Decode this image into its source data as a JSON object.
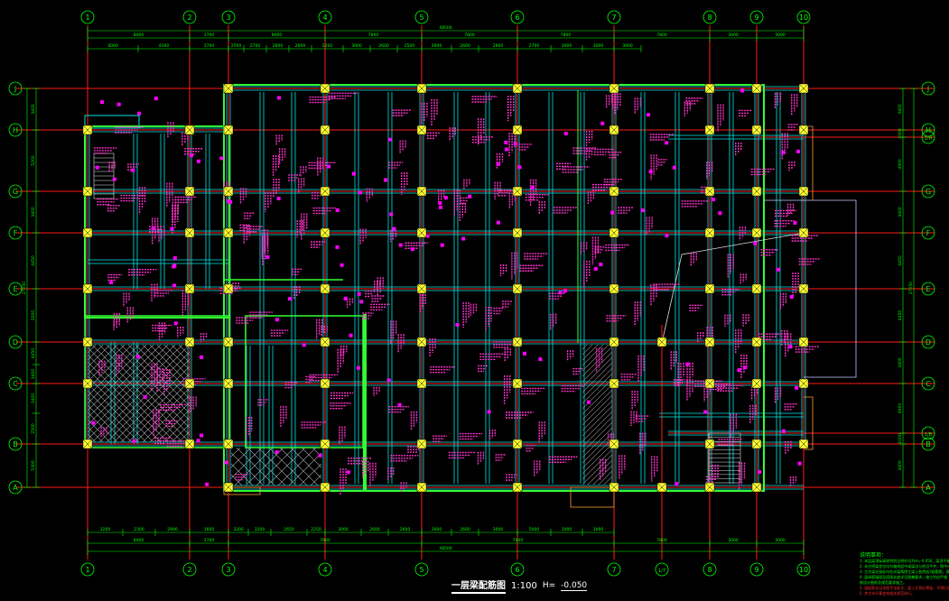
{
  "drawing": {
    "title": "一层梁配筋图",
    "scale": "1:100",
    "elevation_label": "H=",
    "elevation_value": "-0.050"
  },
  "axes": {
    "columns": [
      "1",
      "2",
      "3",
      "4",
      "5",
      "6",
      "7",
      "8",
      "9",
      "10"
    ],
    "extra_column": "1/7",
    "rows": [
      "A",
      "B",
      "C",
      "D",
      "E",
      "F",
      "G",
      "H",
      "J"
    ],
    "extra_rows": [
      "1/H",
      "1/B"
    ]
  },
  "dimensions": {
    "total": "48500",
    "top_bays": [
      "8400",
      "3700",
      "8000",
      "7800",
      "7800",
      "7800",
      "7800",
      "3000",
      "3000"
    ],
    "top_sub": [
      "4000",
      "4300",
      "3700",
      "2500",
      "2700",
      "2800",
      "2600",
      "2200",
      "3000",
      "2600",
      "2500",
      "2600",
      "2600",
      "2600",
      "2700",
      "3000",
      "3000",
      "3000"
    ],
    "bottom_sub": [
      "3200",
      "2300",
      "2900",
      "1600",
      "3200",
      "3200",
      "2650",
      "2250",
      "3000",
      "2600",
      "2600",
      "2600",
      "2600",
      "3000",
      "5000",
      "3000",
      "3000"
    ],
    "bottom_bays": [
      "8400",
      "3700",
      "7800",
      "7800",
      "7800",
      "3000",
      "3000"
    ],
    "bottom_total": "48500",
    "left_dims": [
      "3400",
      "5200",
      "3400",
      "4450",
      "2000",
      "4450",
      "3400",
      "3400",
      "2500",
      "5300",
      "3400"
    ],
    "left_total": "27050",
    "right_dims": [
      "3400",
      "1000",
      "4900",
      "3400",
      "4450",
      "4450",
      "3400",
      "4000",
      "1000",
      "3400"
    ],
    "right_total": "27050"
  },
  "notes": {
    "title": "说明事项：",
    "lines": [
      "1. 本层梁顶标高除特别注明外均为H=-0.050，梁顶平板顶",
      "2. 未注明梁定位均为轴线居中或梁边与柱边平齐，图中未注明",
      "3. 主次梁交接处均在次梁两侧主梁上各附加3组箍筋，直径同",
      "4. 梁纵筋锚固及搭接长度详见图集要求，施工时应严格",
      "   按设计图纸及规范要求施工。",
      "5. 梁配筋详见本图平法标注，梁上开洞应预留，不得后凿",
      "6. 其它未尽事宜按相关规范执行。"
    ]
  },
  "colors": {
    "background": "#000000",
    "axis_line": "#ff1a1a",
    "dimension": "#00ff00",
    "beam": "#00e5e5",
    "wall": "#33ff33",
    "annotation": "#ff33cc",
    "column": "#ffff33",
    "axis_bubble": "#00ff00"
  }
}
